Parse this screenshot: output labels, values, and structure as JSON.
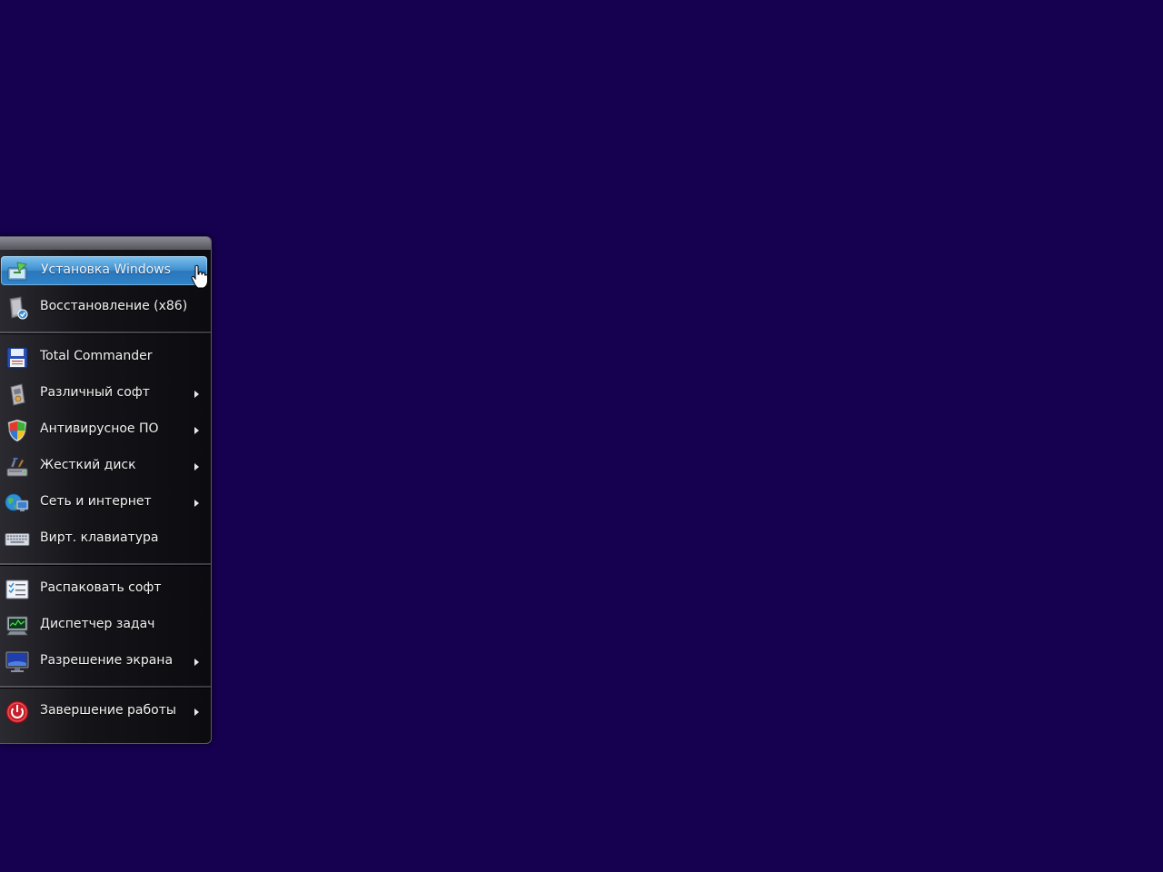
{
  "menu": {
    "items": [
      {
        "label": "Установка Windows",
        "icon": "windows-setup-icon",
        "submenu": false,
        "selected": true
      },
      {
        "label": "Восстановление (x86)",
        "icon": "recovery-drive-icon",
        "submenu": false
      },
      {
        "label": "Total Commander",
        "icon": "floppy-disk-icon",
        "submenu": false
      },
      {
        "label": "Различный софт",
        "icon": "software-package-icon",
        "submenu": true
      },
      {
        "label": "Антивирусное ПО",
        "icon": "security-shield-icon",
        "submenu": true
      },
      {
        "label": "Жесткий диск",
        "icon": "hard-disk-tools-icon",
        "submenu": true
      },
      {
        "label": "Сеть и интернет",
        "icon": "network-globe-icon",
        "submenu": true
      },
      {
        "label": "Вирт. клавиатура",
        "icon": "keyboard-icon",
        "submenu": false
      },
      {
        "label": "Распаковать софт",
        "icon": "checklist-icon",
        "submenu": false
      },
      {
        "label": "Диспетчер задач",
        "icon": "task-manager-icon",
        "submenu": false
      },
      {
        "label": "Разрешение экрана",
        "icon": "monitor-icon",
        "submenu": true
      },
      {
        "label": "Завершение работы",
        "icon": "power-icon",
        "submenu": true
      }
    ]
  },
  "colors": {
    "desktop_background": "#160050",
    "selection_highlight": "#3f8fcf",
    "menu_background": "#141418"
  }
}
